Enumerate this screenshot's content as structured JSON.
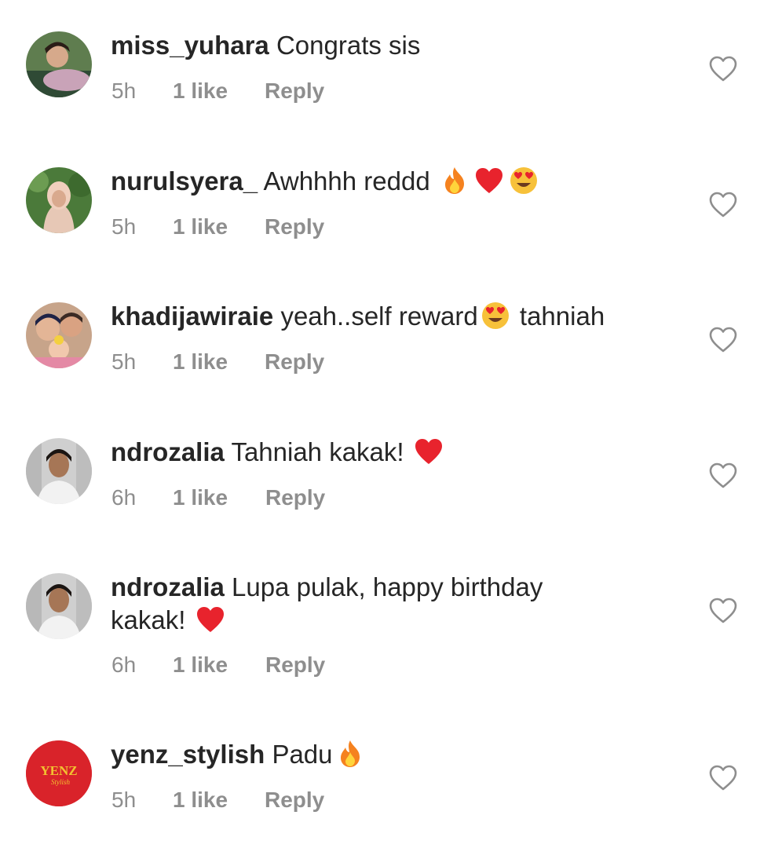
{
  "comments": [
    {
      "username": "miss_yuhara",
      "text": "Congrats sis",
      "time": "5h",
      "likes": "1 like",
      "reply": "Reply",
      "emojis": []
    },
    {
      "username": "nurulsyera_",
      "text": "Awhhhh reddd",
      "time": "5h",
      "likes": "1 like",
      "reply": "Reply",
      "emojis": [
        "fire",
        "red-heart",
        "heart-eyes"
      ]
    },
    {
      "username": "khadijawiraie",
      "text": "yeah..self reward",
      "text_after": "tahniah",
      "time": "5h",
      "likes": "1 like",
      "reply": "Reply",
      "emojis": [
        "heart-eyes"
      ]
    },
    {
      "username": "ndrozalia",
      "text": "Tahniah kakak!",
      "time": "6h",
      "likes": "1 like",
      "reply": "Reply",
      "emojis": [
        "red-heart"
      ]
    },
    {
      "username": "ndrozalia",
      "text": "Lupa pulak, happy birthday kakak!",
      "time": "6h",
      "likes": "1 like",
      "reply": "Reply",
      "emojis": [
        "red-heart"
      ]
    },
    {
      "username": "yenz_stylish",
      "text": "Padu",
      "time": "5h",
      "likes": "1 like",
      "reply": "Reply",
      "emojis": [
        "fire"
      ],
      "avatar_text": "YENZ",
      "avatar_subtext": "Stylish"
    }
  ],
  "colors": {
    "text": "#262626",
    "meta": "#8e8e8e",
    "heart_outline": "#8e8e8e",
    "yenz_avatar_bg": "#d9232a",
    "yenz_avatar_text": "#f2c230"
  }
}
